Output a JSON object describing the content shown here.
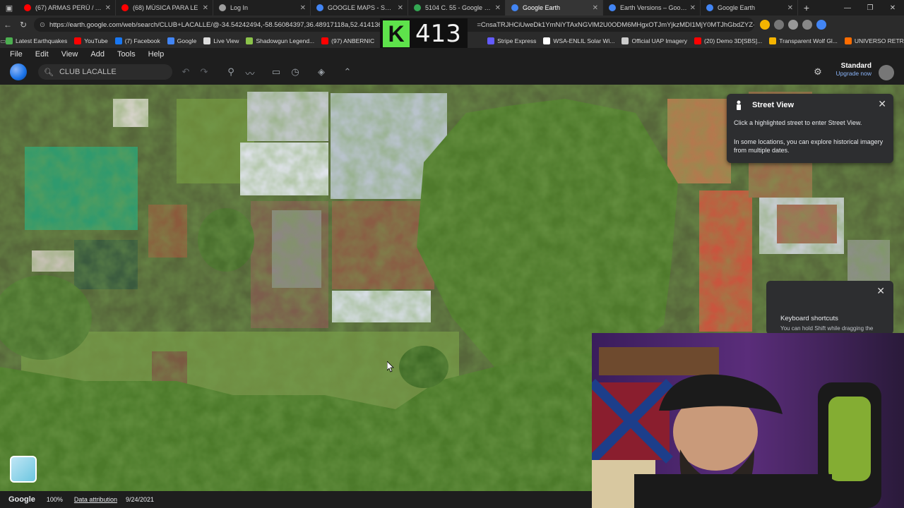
{
  "browser": {
    "tabs": [
      {
        "title": "(67) ARMAS PERÚ / ARMAS",
        "color": "#ff0000",
        "active": false
      },
      {
        "title": "(68) MÚSICA PARA LE",
        "color": "#ff0000",
        "active": false
      },
      {
        "title": "Log In",
        "color": "#9e9e9e",
        "active": false
      },
      {
        "title": "GOOGLE MAPS - Search",
        "color": "#4285f4",
        "active": false
      },
      {
        "title": "5104 C. 55 - Google Maps",
        "color": "#34a853",
        "active": false
      },
      {
        "title": "Google Earth",
        "color": "#4285f4",
        "active": true
      },
      {
        "title": "Earth Versions – Google Ea",
        "color": "#4285f4",
        "active": false
      },
      {
        "title": "Google Earth",
        "color": "#4285f4",
        "active": false
      }
    ],
    "url": "https://earth.google.com/web/search/CLUB+LACALLE/@-34.54242494,-58.56084397,36.48917118a,52.41413639",
    "url_tail": "=CnsaTRJHCiUweDk1YmNiYTAxNGVlM2U0ODM6MHgxOTJmYjkzMDI1MjY0MTJhGbdZYZ-IRU...",
    "bookmarks": [
      {
        "label": "Latest Earthquakes",
        "color": "#4caf50"
      },
      {
        "label": "YouTube",
        "color": "#ff0000"
      },
      {
        "label": "(7) Facebook",
        "color": "#1877f2"
      },
      {
        "label": "Google",
        "color": "#4285f4"
      },
      {
        "label": "Live View",
        "color": "#dddddd"
      },
      {
        "label": "Shadowgun Legend...",
        "color": "#8bc34a"
      },
      {
        "label": "(97) ANBERNIC",
        "color": "#ff0000"
      },
      {
        "label": "Stripe Express",
        "color": "#635bff"
      },
      {
        "label": "WSA-ENLIL Solar Wi...",
        "color": "#ffffff"
      },
      {
        "label": "Official UAP Imagery",
        "color": "#cccccc"
      },
      {
        "label": "(20) Demo 3D[SBS]...",
        "color": "#ff0000"
      },
      {
        "label": "Transparent Wolf Gl...",
        "color": "#f4b400"
      },
      {
        "label": "UNIVERSO RETRO...",
        "color": "#ff6d00"
      }
    ]
  },
  "overlay": {
    "letter": "K",
    "count": "413"
  },
  "earth": {
    "menu": [
      "File",
      "Edit",
      "View",
      "Add",
      "Tools",
      "Help"
    ],
    "search_placeholder": "CLUB LACALLE",
    "plan": {
      "name": "Standard",
      "upgrade": "Upgrade now"
    },
    "street_view": {
      "title": "Street View",
      "line1": "Click a highlighted street to enter Street View.",
      "line2": "In some locations, you can explore historical imagery from multiple dates."
    },
    "keyboard": {
      "title": "Keyboard shortcuts",
      "text": "You can hold Shift while dragging the"
    },
    "status": {
      "brand": "Google",
      "zoom": "100%",
      "attribution": "Data attribution",
      "date": "9/24/2021"
    }
  }
}
